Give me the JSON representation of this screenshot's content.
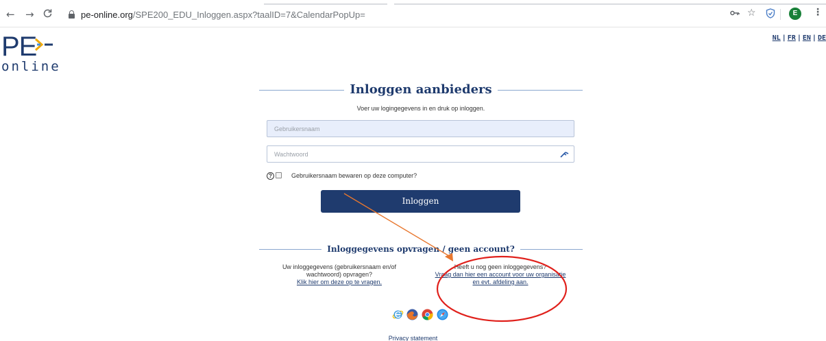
{
  "browser": {
    "back": "←",
    "forward": "→",
    "reload": "C",
    "url_domain": "pe-online.org",
    "url_path": "/SPE200_EDU_Inloggen.aspx?taalID=7&CalendarPopUp=",
    "profile_initial": "E",
    "menu": "⋮"
  },
  "logo": {
    "pe": "PE",
    "online": "online"
  },
  "languages": [
    "NL",
    "FR",
    "EN",
    "DE"
  ],
  "login": {
    "title": "Inloggen aanbieders",
    "subtitle": "Voer uw logingegevens in en druk op inloggen.",
    "username_placeholder": "Gebruikersnaam",
    "password_placeholder": "Wachtwoord",
    "remember_label": "Gebruikersnaam bewaren op deze computer?",
    "button_label": "Inloggen"
  },
  "account": {
    "title": "Inloggegevens opvragen / geen account?",
    "left_text_1": "Uw inloggegevens (gebruikersnaam en/of",
    "left_text_2": "wachtwoord) opvragen?",
    "left_link": "Klik hier om deze op te vragen.",
    "right_text": "Heeft u nog geen inloggegevens?",
    "right_link_1": "Vraag dan hier een account voor uw organisatie",
    "right_link_2": "en evt. afdeling aan."
  },
  "footer": {
    "privacy": "Privacy statement"
  },
  "colors": {
    "brand": "#1f3b6e",
    "rule": "#8aa7cf",
    "annotation_circle": "#e0201b",
    "annotation_arrow": "#e8772e"
  }
}
